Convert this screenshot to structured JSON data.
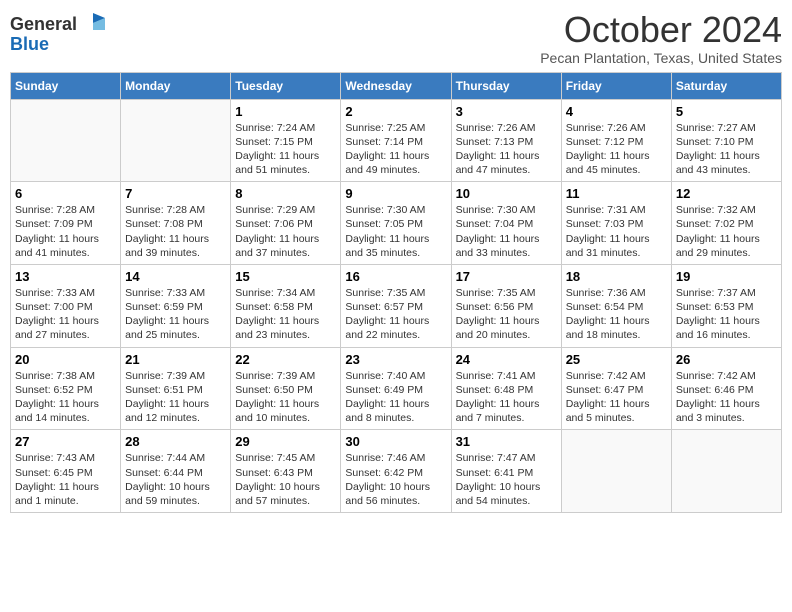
{
  "header": {
    "logo_line1": "General",
    "logo_line2": "Blue",
    "month_title": "October 2024",
    "location": "Pecan Plantation, Texas, United States"
  },
  "weekdays": [
    "Sunday",
    "Monday",
    "Tuesday",
    "Wednesday",
    "Thursday",
    "Friday",
    "Saturday"
  ],
  "weeks": [
    [
      {
        "day": "",
        "sunrise": "",
        "sunset": "",
        "daylight": ""
      },
      {
        "day": "",
        "sunrise": "",
        "sunset": "",
        "daylight": ""
      },
      {
        "day": "1",
        "sunrise": "Sunrise: 7:24 AM",
        "sunset": "Sunset: 7:15 PM",
        "daylight": "Daylight: 11 hours and 51 minutes."
      },
      {
        "day": "2",
        "sunrise": "Sunrise: 7:25 AM",
        "sunset": "Sunset: 7:14 PM",
        "daylight": "Daylight: 11 hours and 49 minutes."
      },
      {
        "day": "3",
        "sunrise": "Sunrise: 7:26 AM",
        "sunset": "Sunset: 7:13 PM",
        "daylight": "Daylight: 11 hours and 47 minutes."
      },
      {
        "day": "4",
        "sunrise": "Sunrise: 7:26 AM",
        "sunset": "Sunset: 7:12 PM",
        "daylight": "Daylight: 11 hours and 45 minutes."
      },
      {
        "day": "5",
        "sunrise": "Sunrise: 7:27 AM",
        "sunset": "Sunset: 7:10 PM",
        "daylight": "Daylight: 11 hours and 43 minutes."
      }
    ],
    [
      {
        "day": "6",
        "sunrise": "Sunrise: 7:28 AM",
        "sunset": "Sunset: 7:09 PM",
        "daylight": "Daylight: 11 hours and 41 minutes."
      },
      {
        "day": "7",
        "sunrise": "Sunrise: 7:28 AM",
        "sunset": "Sunset: 7:08 PM",
        "daylight": "Daylight: 11 hours and 39 minutes."
      },
      {
        "day": "8",
        "sunrise": "Sunrise: 7:29 AM",
        "sunset": "Sunset: 7:06 PM",
        "daylight": "Daylight: 11 hours and 37 minutes."
      },
      {
        "day": "9",
        "sunrise": "Sunrise: 7:30 AM",
        "sunset": "Sunset: 7:05 PM",
        "daylight": "Daylight: 11 hours and 35 minutes."
      },
      {
        "day": "10",
        "sunrise": "Sunrise: 7:30 AM",
        "sunset": "Sunset: 7:04 PM",
        "daylight": "Daylight: 11 hours and 33 minutes."
      },
      {
        "day": "11",
        "sunrise": "Sunrise: 7:31 AM",
        "sunset": "Sunset: 7:03 PM",
        "daylight": "Daylight: 11 hours and 31 minutes."
      },
      {
        "day": "12",
        "sunrise": "Sunrise: 7:32 AM",
        "sunset": "Sunset: 7:02 PM",
        "daylight": "Daylight: 11 hours and 29 minutes."
      }
    ],
    [
      {
        "day": "13",
        "sunrise": "Sunrise: 7:33 AM",
        "sunset": "Sunset: 7:00 PM",
        "daylight": "Daylight: 11 hours and 27 minutes."
      },
      {
        "day": "14",
        "sunrise": "Sunrise: 7:33 AM",
        "sunset": "Sunset: 6:59 PM",
        "daylight": "Daylight: 11 hours and 25 minutes."
      },
      {
        "day": "15",
        "sunrise": "Sunrise: 7:34 AM",
        "sunset": "Sunset: 6:58 PM",
        "daylight": "Daylight: 11 hours and 23 minutes."
      },
      {
        "day": "16",
        "sunrise": "Sunrise: 7:35 AM",
        "sunset": "Sunset: 6:57 PM",
        "daylight": "Daylight: 11 hours and 22 minutes."
      },
      {
        "day": "17",
        "sunrise": "Sunrise: 7:35 AM",
        "sunset": "Sunset: 6:56 PM",
        "daylight": "Daylight: 11 hours and 20 minutes."
      },
      {
        "day": "18",
        "sunrise": "Sunrise: 7:36 AM",
        "sunset": "Sunset: 6:54 PM",
        "daylight": "Daylight: 11 hours and 18 minutes."
      },
      {
        "day": "19",
        "sunrise": "Sunrise: 7:37 AM",
        "sunset": "Sunset: 6:53 PM",
        "daylight": "Daylight: 11 hours and 16 minutes."
      }
    ],
    [
      {
        "day": "20",
        "sunrise": "Sunrise: 7:38 AM",
        "sunset": "Sunset: 6:52 PM",
        "daylight": "Daylight: 11 hours and 14 minutes."
      },
      {
        "day": "21",
        "sunrise": "Sunrise: 7:39 AM",
        "sunset": "Sunset: 6:51 PM",
        "daylight": "Daylight: 11 hours and 12 minutes."
      },
      {
        "day": "22",
        "sunrise": "Sunrise: 7:39 AM",
        "sunset": "Sunset: 6:50 PM",
        "daylight": "Daylight: 11 hours and 10 minutes."
      },
      {
        "day": "23",
        "sunrise": "Sunrise: 7:40 AM",
        "sunset": "Sunset: 6:49 PM",
        "daylight": "Daylight: 11 hours and 8 minutes."
      },
      {
        "day": "24",
        "sunrise": "Sunrise: 7:41 AM",
        "sunset": "Sunset: 6:48 PM",
        "daylight": "Daylight: 11 hours and 7 minutes."
      },
      {
        "day": "25",
        "sunrise": "Sunrise: 7:42 AM",
        "sunset": "Sunset: 6:47 PM",
        "daylight": "Daylight: 11 hours and 5 minutes."
      },
      {
        "day": "26",
        "sunrise": "Sunrise: 7:42 AM",
        "sunset": "Sunset: 6:46 PM",
        "daylight": "Daylight: 11 hours and 3 minutes."
      }
    ],
    [
      {
        "day": "27",
        "sunrise": "Sunrise: 7:43 AM",
        "sunset": "Sunset: 6:45 PM",
        "daylight": "Daylight: 11 hours and 1 minute."
      },
      {
        "day": "28",
        "sunrise": "Sunrise: 7:44 AM",
        "sunset": "Sunset: 6:44 PM",
        "daylight": "Daylight: 10 hours and 59 minutes."
      },
      {
        "day": "29",
        "sunrise": "Sunrise: 7:45 AM",
        "sunset": "Sunset: 6:43 PM",
        "daylight": "Daylight: 10 hours and 57 minutes."
      },
      {
        "day": "30",
        "sunrise": "Sunrise: 7:46 AM",
        "sunset": "Sunset: 6:42 PM",
        "daylight": "Daylight: 10 hours and 56 minutes."
      },
      {
        "day": "31",
        "sunrise": "Sunrise: 7:47 AM",
        "sunset": "Sunset: 6:41 PM",
        "daylight": "Daylight: 10 hours and 54 minutes."
      },
      {
        "day": "",
        "sunrise": "",
        "sunset": "",
        "daylight": ""
      },
      {
        "day": "",
        "sunrise": "",
        "sunset": "",
        "daylight": ""
      }
    ]
  ]
}
